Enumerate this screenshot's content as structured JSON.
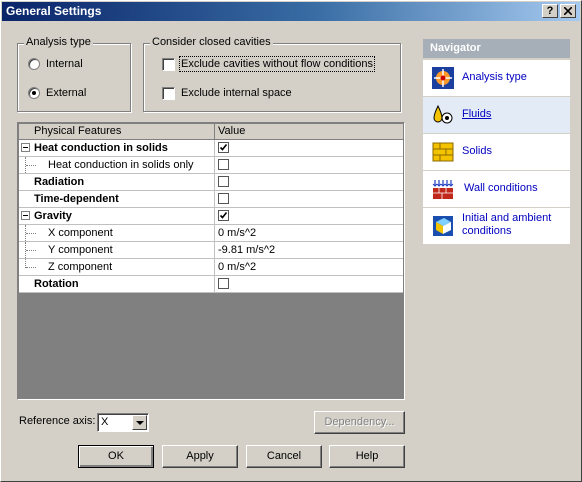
{
  "window": {
    "title": "General Settings",
    "help_button": "?",
    "close_button": "X"
  },
  "analysis_type": {
    "group_label": "Analysis type",
    "options": [
      {
        "label": "Internal",
        "selected": false
      },
      {
        "label": "External",
        "selected": true
      }
    ]
  },
  "closed_cavities": {
    "group_label": "Consider closed cavities",
    "options": [
      {
        "label": "Exclude cavities without flow conditions",
        "checked": false
      },
      {
        "label": "Exclude internal space",
        "checked": false
      }
    ]
  },
  "grid": {
    "col_feature": "Physical Features",
    "col_value": "Value",
    "rows": [
      {
        "name": "Heat conduction in solids",
        "bold": true,
        "expander": true,
        "value_type": "checkbox",
        "checked": true
      },
      {
        "name": "Heat conduction in solids only",
        "child": true,
        "value_type": "checkbox",
        "checked": false
      },
      {
        "name": "Radiation",
        "bold": true,
        "value_type": "checkbox",
        "checked": false
      },
      {
        "name": "Time-dependent",
        "bold": true,
        "value_type": "checkbox",
        "checked": false
      },
      {
        "name": "Gravity",
        "bold": true,
        "expander": true,
        "value_type": "checkbox",
        "checked": true
      },
      {
        "name": "X component",
        "child": true,
        "value_type": "text",
        "value": "0 m/s^2"
      },
      {
        "name": "Y component",
        "child": true,
        "value_type": "text",
        "value": "-9.81 m/s^2"
      },
      {
        "name": "Z component",
        "child": true,
        "value_type": "text",
        "value": "0 m/s^2"
      },
      {
        "name": "Rotation",
        "bold": true,
        "value_type": "checkbox",
        "checked": false
      }
    ]
  },
  "navigator": {
    "title": "Navigator",
    "items": [
      {
        "label": "Analysis type",
        "icon": "analysis-type-icon"
      },
      {
        "label": "Fluids",
        "icon": "fluids-icon",
        "selected": true
      },
      {
        "label": "Solids",
        "icon": "solids-icon"
      },
      {
        "label": "Wall conditions",
        "icon": "wall-conditions-icon"
      },
      {
        "label": "Initial and ambient conditions",
        "icon": "initial-conditions-icon"
      }
    ]
  },
  "reference_axis": {
    "label": "Reference axis:",
    "value": "X"
  },
  "buttons": {
    "dependency": "Dependency...",
    "ok": "OK",
    "apply": "Apply",
    "cancel": "Cancel",
    "help": "Help"
  }
}
